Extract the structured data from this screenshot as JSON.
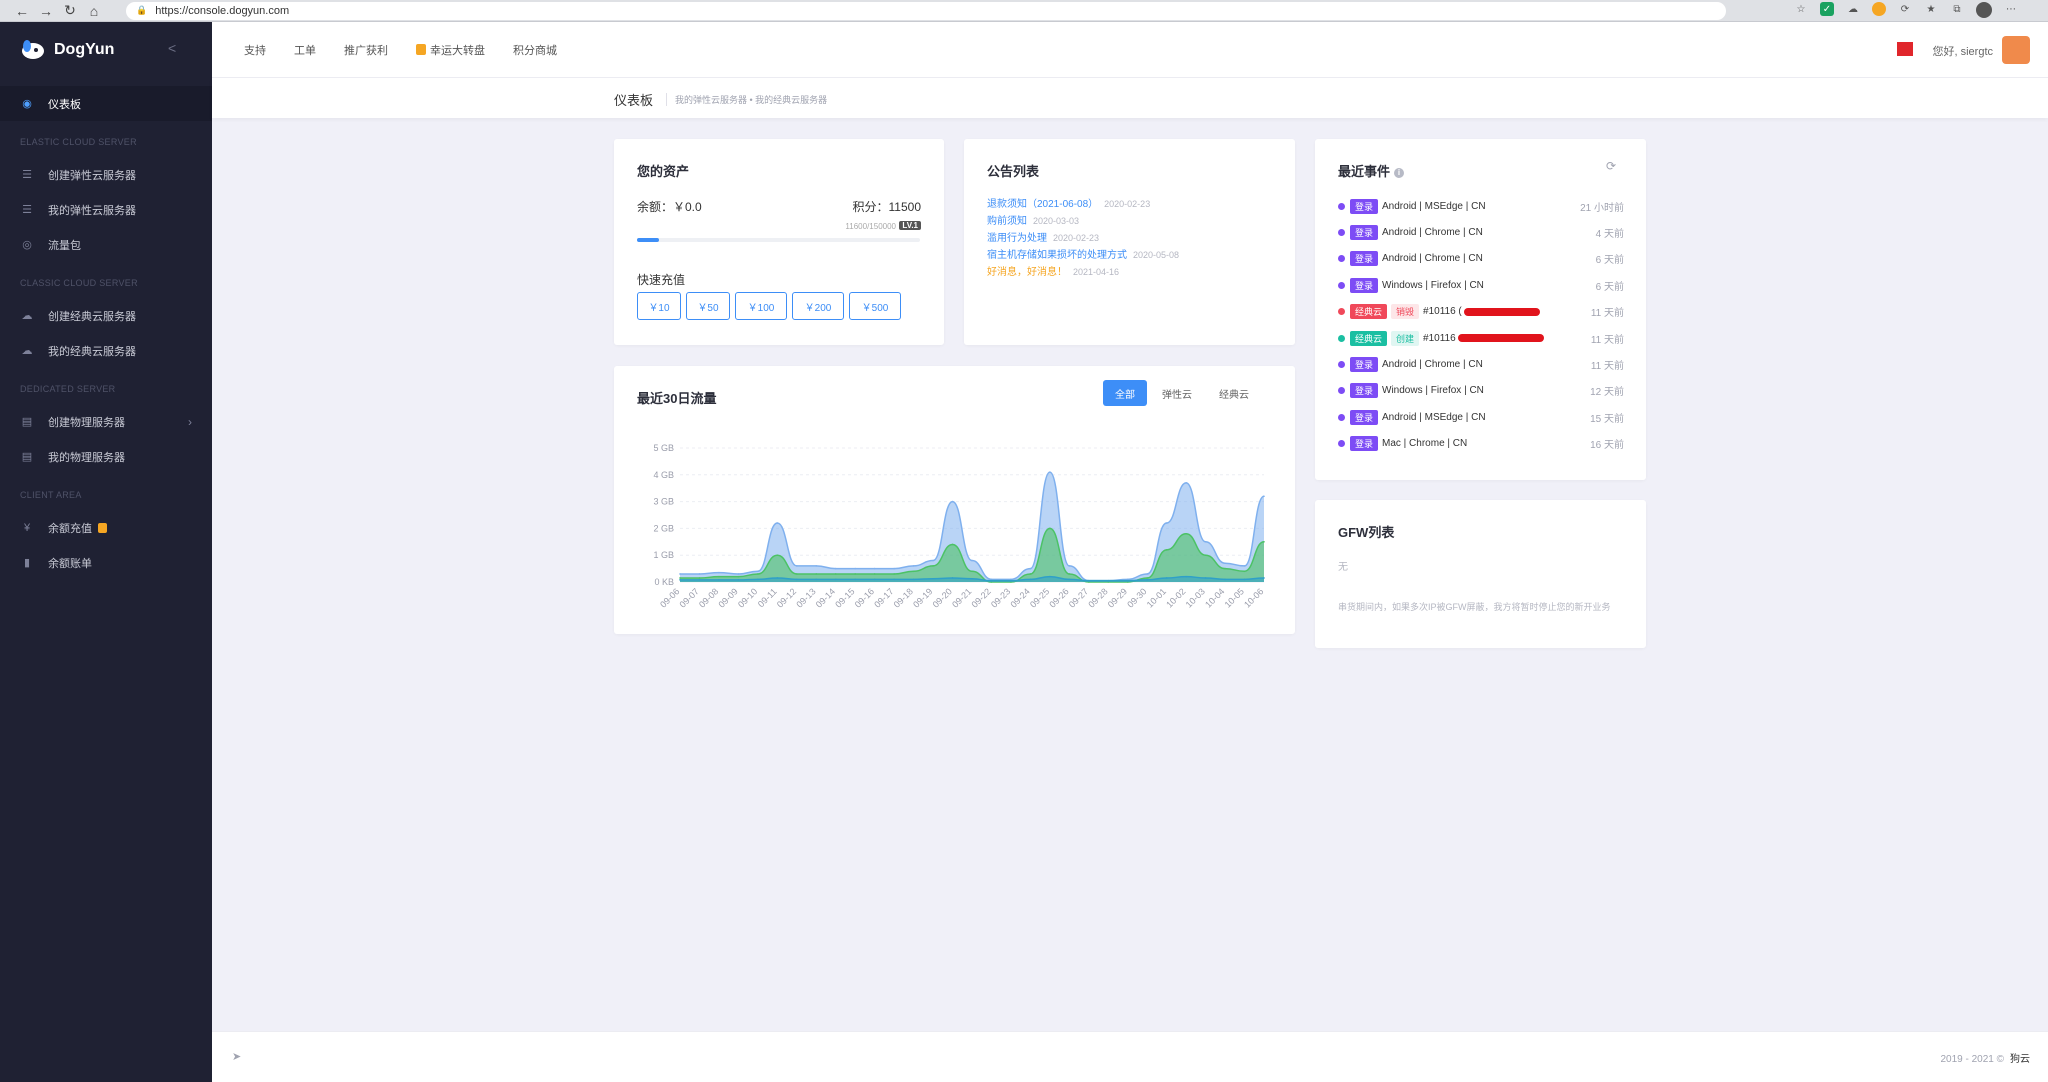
{
  "browser": {
    "url": "https://console.dogyun.com",
    "nav": [
      "←",
      "→",
      "↻",
      "⌂"
    ]
  },
  "sidebar": {
    "brand": "DogYun",
    "items": [
      {
        "label": "仪表板",
        "icon": "dashboard-icon",
        "active": true
      },
      {
        "section": "ELASTIC CLOUD SERVER"
      },
      {
        "label": "创建弹性云服务器",
        "icon": "server-icon"
      },
      {
        "label": "我的弹性云服务器",
        "icon": "server-icon"
      },
      {
        "label": "流量包",
        "icon": "globe-icon"
      },
      {
        "section": "CLASSIC CLOUD SERVER"
      },
      {
        "label": "创建经典云服务器",
        "icon": "cloud-icon"
      },
      {
        "label": "我的经典云服务器",
        "icon": "cloud-icon"
      },
      {
        "section": "DEDICATED SERVER"
      },
      {
        "label": "创建物理服务器",
        "icon": "rack-icon",
        "chevron": true
      },
      {
        "label": "我的物理服务器",
        "icon": "rack-icon"
      },
      {
        "section": "CLIENT AREA"
      },
      {
        "label": "余额充值",
        "icon": "yen-icon",
        "gift": true
      },
      {
        "label": "余额账单",
        "icon": "bill-icon"
      }
    ]
  },
  "topbar": {
    "links": [
      "支持",
      "工单",
      "推广获利",
      "幸运大转盘",
      "积分商城"
    ],
    "greeting": "您好, siergtc"
  },
  "subbar": {
    "title": "仪表板",
    "breadcrumb": "我的弹性云服务器 • 我的经典云服务器"
  },
  "assets": {
    "title": "您的资产",
    "balance": "余额：￥0.0",
    "points": "积分：11500",
    "level_progress": "11600/150000",
    "level": "LV.1",
    "progress_fraction": 0.077,
    "recharge_label": "快速充值",
    "recharge_options": [
      "￥10",
      "￥50",
      "￥100",
      "￥200",
      "￥500"
    ]
  },
  "announcements": {
    "title": "公告列表",
    "items": [
      {
        "title": "退款须知（2021-06-08）",
        "date": "2020-02-23"
      },
      {
        "title": "购前须知",
        "date": "2020-03-03"
      },
      {
        "title": "滥用行为处理",
        "date": "2020-02-23"
      },
      {
        "title": "宿主机存储如果损坏的处理方式",
        "date": "2020-05-08"
      },
      {
        "title": "好消息，好消息！",
        "date": "2021-04-16",
        "hot": true
      }
    ]
  },
  "events": {
    "title": "最近事件",
    "items": [
      {
        "dot": "#7d4cf5",
        "tag": "登录",
        "tagColor": "#7d4cf5",
        "text": "Android | MSEdge | CN",
        "time": "21 小时前"
      },
      {
        "dot": "#7d4cf5",
        "tag": "登录",
        "tagColor": "#7d4cf5",
        "text": "Android | Chrome | CN",
        "time": "4 天前"
      },
      {
        "dot": "#7d4cf5",
        "tag": "登录",
        "tagColor": "#7d4cf5",
        "text": "Android | Chrome | CN",
        "time": "6 天前"
      },
      {
        "dot": "#7d4cf5",
        "tag": "登录",
        "tagColor": "#7d4cf5",
        "text": "Windows | Firefox | CN",
        "time": "6 天前"
      },
      {
        "dot": "#f0485a",
        "tag": "经典云",
        "tagColor": "#f0485a",
        "sub": "销毁",
        "subColor": "#f0485a",
        "subBg": "#fde6e8",
        "text": "#10116 (",
        "redact": 76,
        "time": "11 天前"
      },
      {
        "dot": "#1bbfa2",
        "tag": "经典云",
        "tagColor": "#1bbfa2",
        "sub": "创建",
        "subColor": "#1bbfa2",
        "subBg": "#e0f6f2",
        "text": "#10116",
        "redact": 86,
        "time": "11 天前"
      },
      {
        "dot": "#7d4cf5",
        "tag": "登录",
        "tagColor": "#7d4cf5",
        "text": "Android | Chrome | CN",
        "time": "11 天前"
      },
      {
        "dot": "#7d4cf5",
        "tag": "登录",
        "tagColor": "#7d4cf5",
        "text": "Windows | Firefox | CN",
        "time": "12 天前"
      },
      {
        "dot": "#7d4cf5",
        "tag": "登录",
        "tagColor": "#7d4cf5",
        "text": "Android | MSEdge | CN",
        "time": "15 天前"
      },
      {
        "dot": "#7d4cf5",
        "tag": "登录",
        "tagColor": "#7d4cf5",
        "text": "Mac | Chrome | CN",
        "time": "16 天前"
      }
    ]
  },
  "gfw": {
    "title": "GFW列表",
    "none": "无",
    "note": "串货期间内，如果多次IP被GFW屏蔽，我方将暂时停止您的新开业务"
  },
  "traffic": {
    "title": "最近30日流量",
    "tabs": [
      "全部",
      "弹性云",
      "经典云"
    ],
    "active_tab": 0
  },
  "chart_data": {
    "type": "area",
    "title": "最近30日流量",
    "ylim": [
      0,
      5
    ],
    "yticks": [
      "0 KB",
      "1 GB",
      "2 GB",
      "3 GB",
      "4 GB",
      "5 GB"
    ],
    "x": [
      "09-06",
      "09-07",
      "09-08",
      "09-09",
      "09-10",
      "09-11",
      "09-12",
      "09-13",
      "09-14",
      "09-15",
      "09-16",
      "09-17",
      "09-18",
      "09-19",
      "09-20",
      "09-21",
      "09-22",
      "09-23",
      "09-24",
      "09-25",
      "09-26",
      "09-27",
      "09-28",
      "09-29",
      "09-30",
      "10-01",
      "10-02",
      "10-03",
      "10-04",
      "10-05",
      "10-06"
    ],
    "series": [
      {
        "color": "#7fb0ee",
        "values": [
          0.3,
          0.3,
          0.35,
          0.3,
          0.4,
          2.2,
          0.6,
          0.6,
          0.5,
          0.5,
          0.5,
          0.5,
          0.6,
          0.8,
          3.0,
          0.8,
          0.1,
          0.1,
          0.5,
          4.1,
          0.6,
          0.05,
          0.05,
          0.1,
          0.3,
          2.2,
          3.7,
          1.5,
          0.7,
          0.6,
          3.2
        ]
      },
      {
        "color": "#4cc266",
        "values": [
          0.15,
          0.15,
          0.2,
          0.2,
          0.3,
          1.0,
          0.3,
          0.3,
          0.3,
          0.3,
          0.3,
          0.3,
          0.4,
          0.6,
          1.4,
          0.4,
          0.0,
          0.0,
          0.3,
          2.0,
          0.3,
          0.0,
          0.0,
          0.0,
          0.15,
          1.2,
          1.8,
          1.0,
          0.5,
          0.4,
          1.5
        ]
      },
      {
        "color": "#2fa0c8",
        "values": [
          0.08,
          0.08,
          0.08,
          0.08,
          0.1,
          0.15,
          0.1,
          0.1,
          0.1,
          0.1,
          0.1,
          0.1,
          0.1,
          0.12,
          0.15,
          0.12,
          0.05,
          0.05,
          0.1,
          0.2,
          0.1,
          0.05,
          0.05,
          0.05,
          0.08,
          0.15,
          0.2,
          0.15,
          0.1,
          0.1,
          0.15
        ]
      }
    ]
  },
  "footer": {
    "copyright": "2019 - 2021 ©",
    "brand": "狗云"
  }
}
